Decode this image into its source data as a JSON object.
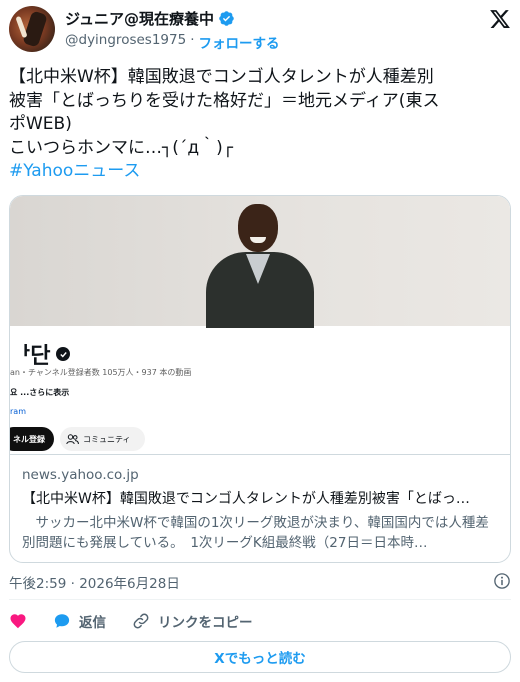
{
  "author": {
    "display_name": "ジュニア@現在療養中",
    "handle": "@dyingroses1975",
    "separator": "·",
    "follow_label": "フォローする",
    "verified_color": "#1d9bf0"
  },
  "tweet": {
    "lines": [
      "【北中米W杯】韓国敗退でコンゴ人タレントが人種差別",
      "被害「とばっちりを受けた格好だ」＝地元メディア(東ス",
      "ポWEB)",
      "こいつらホンマに…┐(´д｀)┌"
    ],
    "hashtag": "#Yahooニュース"
  },
  "card": {
    "channel_name": "ᅡ단",
    "channel_meta": "an・チャンネル登録者数 105万人・937 本の動画",
    "channel_desc": "요 ...さらに表示",
    "channel_link": "ram",
    "subscribe_label": "ネル登録",
    "community_label": "コミュニティ",
    "domain": "news.yahoo.co.jp",
    "title": "【北中米W杯】韓国敗退でコンゴ人タレントが人種差別被害「とばっ…",
    "description": "　サッカー北中米W杯で韓国の1次リーグ敗退が決まり、韓国国内では人種差別問題にも発展している。　1次リーグK組最終戦（27日＝日本時…"
  },
  "timestamp": "午後2:59 · 2026年6月28日",
  "actions": {
    "like_icon": "heart-icon",
    "reply_label": "返信",
    "copy_link_label": "リンクをコピー"
  },
  "read_more_label": "Xでもっと読む",
  "colors": {
    "accent": "#1d9bf0",
    "like": "#f91880",
    "text": "#0f1419",
    "muted": "#536471"
  }
}
